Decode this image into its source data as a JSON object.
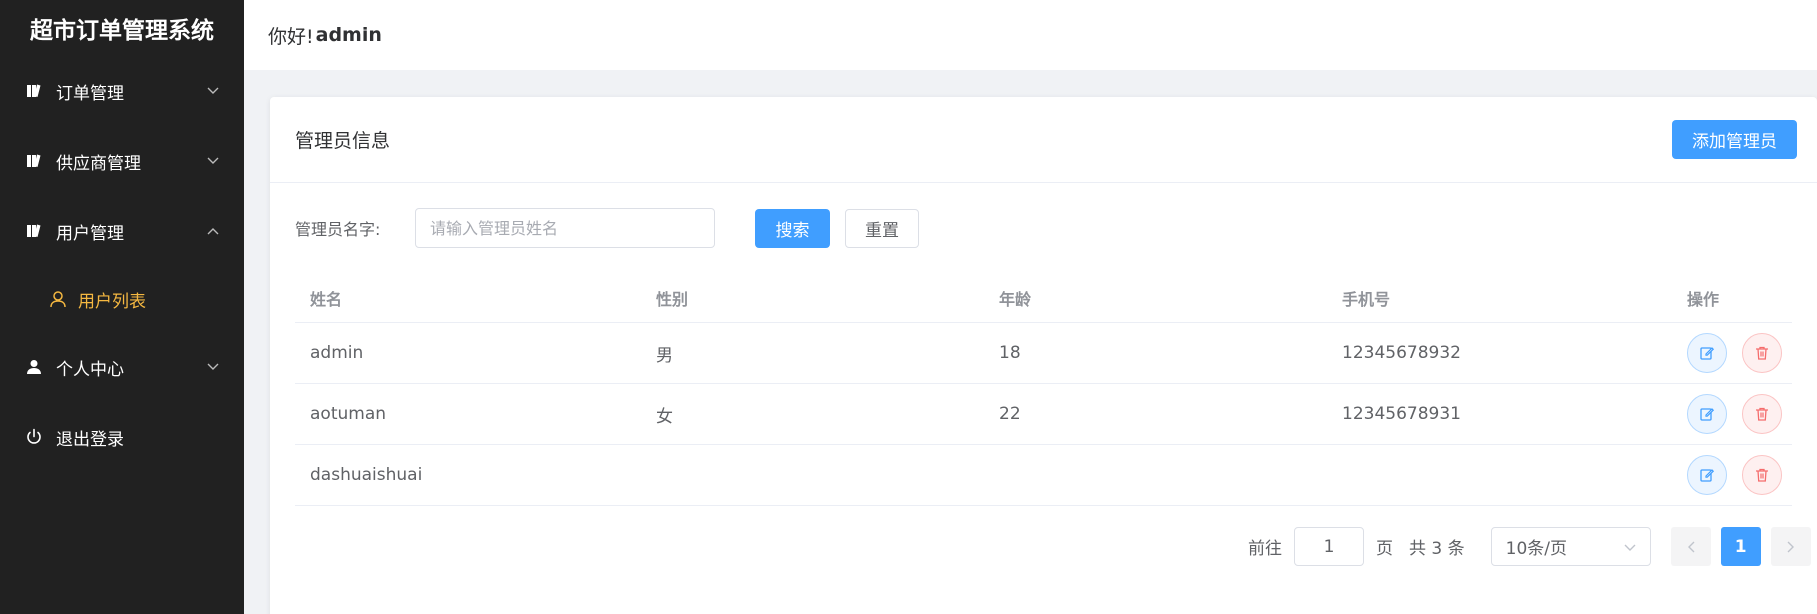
{
  "app": {
    "title": "超市订单管理系统"
  },
  "sidebar": {
    "items": [
      {
        "label": "订单管理",
        "icon": "book-icon",
        "expanded": false
      },
      {
        "label": "供应商管理",
        "icon": "book-icon",
        "expanded": false
      },
      {
        "label": "用户管理",
        "icon": "book-icon",
        "expanded": true
      },
      {
        "label": "个人中心",
        "icon": "person-icon",
        "expanded": false
      },
      {
        "label": "退出登录",
        "icon": "power-icon"
      }
    ],
    "submenu": {
      "label": "用户列表",
      "icon": "user-outline-icon",
      "active": true
    }
  },
  "header": {
    "greeting": "你好!",
    "username": "admin"
  },
  "card": {
    "title": "管理员信息",
    "add_button": "添加管理员"
  },
  "search": {
    "label": "管理员名字:",
    "placeholder": "请输入管理员姓名",
    "value": "",
    "search_button": "搜索",
    "reset_button": "重置"
  },
  "table": {
    "headers": [
      "姓名",
      "性别",
      "年龄",
      "手机号",
      "操作"
    ],
    "rows": [
      {
        "name": "admin",
        "gender": "男",
        "age": "18",
        "phone": "12345678932"
      },
      {
        "name": "aotuman",
        "gender": "女",
        "age": "22",
        "phone": "12345678931"
      },
      {
        "name": "dashuaishuai",
        "gender": "",
        "age": "",
        "phone": ""
      }
    ]
  },
  "pagination": {
    "goto_prefix": "前往",
    "goto_value": "1",
    "goto_suffix": "页",
    "total_text": "共 3 条",
    "page_size": "10条/页",
    "current_page": "1"
  },
  "colors": {
    "primary": "#409eff",
    "sidebar_bg": "#212121",
    "submenu_active": "#f5b841",
    "danger": "#f56c6c"
  }
}
